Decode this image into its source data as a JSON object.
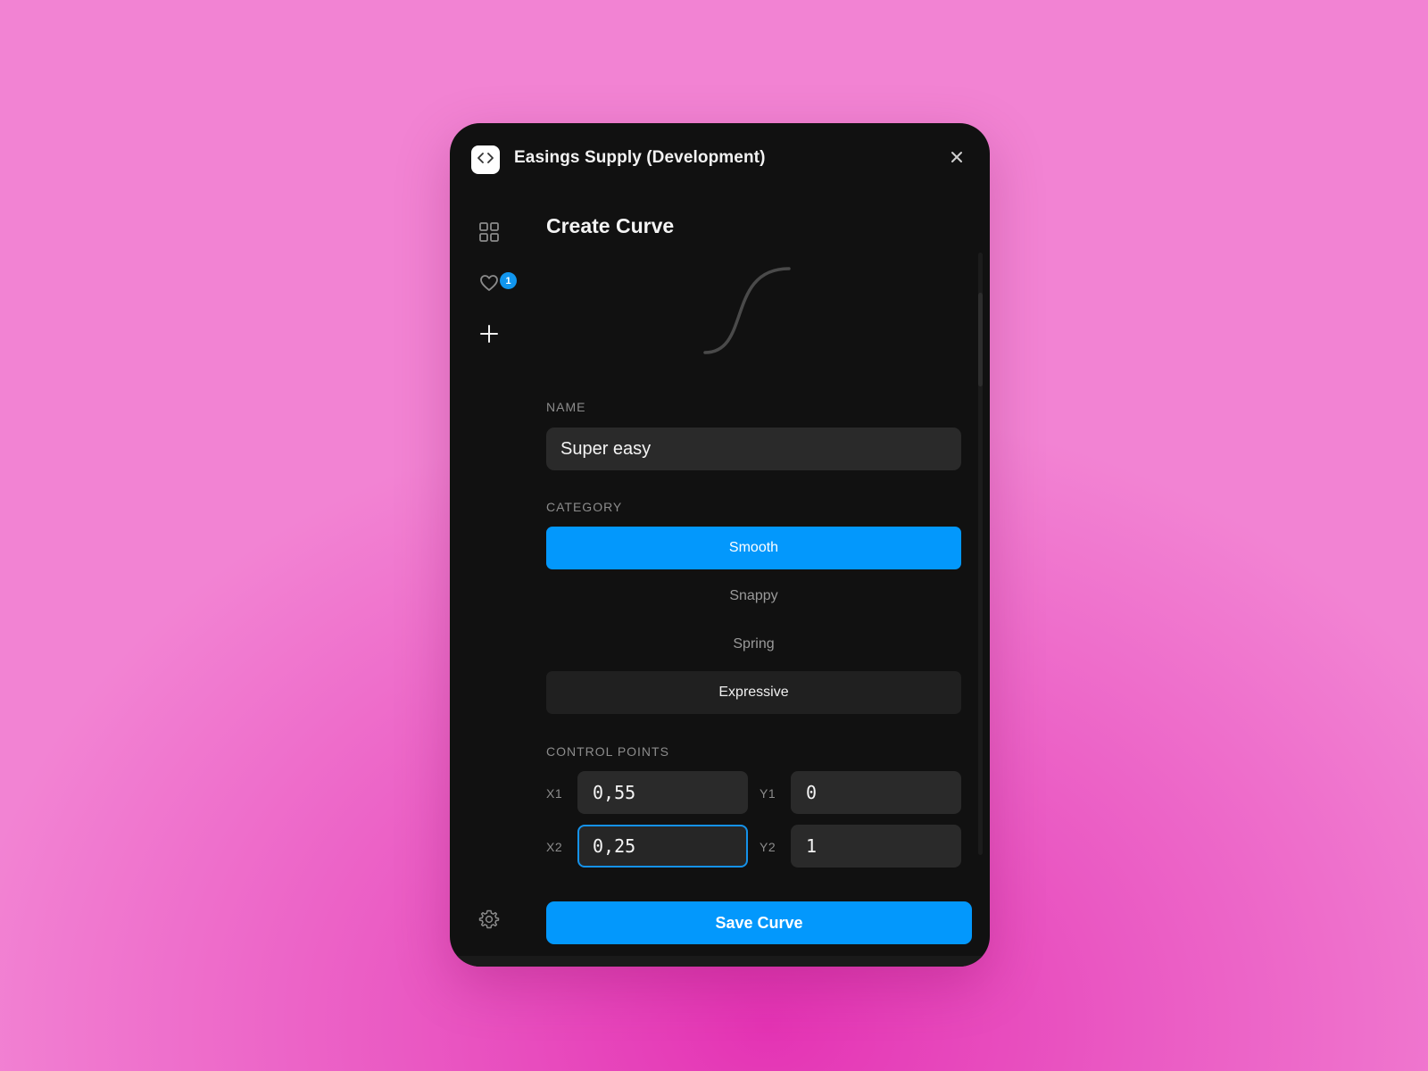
{
  "window": {
    "title": "Easings Supply (Development)"
  },
  "sidebar": {
    "favorites_badge": "1"
  },
  "form": {
    "heading": "Create Curve",
    "name_label": "NAME",
    "name_value": "Super easy",
    "category_label": "CATEGORY",
    "categories": [
      {
        "label": "Smooth",
        "state": "selected"
      },
      {
        "label": "Snappy",
        "state": "default"
      },
      {
        "label": "Spring",
        "state": "default"
      },
      {
        "label": "Expressive",
        "state": "hover"
      }
    ],
    "control_points_label": "CONTROL POINTS",
    "control_points": {
      "x1": {
        "label": "X1",
        "value": "0,55"
      },
      "y1": {
        "label": "Y1",
        "value": "0"
      },
      "x2": {
        "label": "X2",
        "value": "0,25"
      },
      "y2": {
        "label": "Y2",
        "value": "1"
      }
    },
    "save_label": "Save Curve"
  },
  "colors": {
    "accent": "#0398fc",
    "window_bg": "#111111",
    "input_bg": "#2a2a2a"
  },
  "icons": [
    "code-icon",
    "close-icon",
    "grid-icon",
    "heart-icon",
    "plus-icon",
    "gear-icon"
  ]
}
